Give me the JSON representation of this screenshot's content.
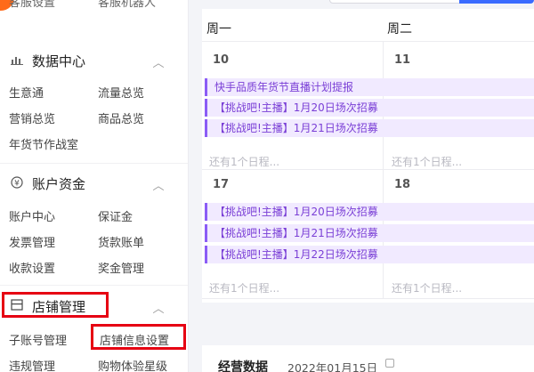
{
  "sidebar": {
    "top_partial": {
      "left": "客服设置",
      "right": "客服机器人"
    },
    "sections": [
      {
        "icon": "chart-icon",
        "title": "数据中心",
        "items": [
          [
            "生意通",
            "流量总览"
          ],
          [
            "营销总览",
            "商品总览"
          ],
          [
            "年货节作战室",
            ""
          ]
        ]
      },
      {
        "icon": "yen-icon",
        "title": "账户资金",
        "items": [
          [
            "账户中心",
            "保证金"
          ],
          [
            "发票管理",
            "货款账单"
          ],
          [
            "收款设置",
            "奖金管理"
          ]
        ]
      },
      {
        "icon": "store-icon",
        "title": "店铺管理",
        "items": [
          [
            "子账号管理",
            "店铺信息设置"
          ],
          [
            "违规管理",
            "购物体验星级"
          ]
        ]
      }
    ]
  },
  "calendar": {
    "weekdays": [
      "周一",
      "周二"
    ],
    "weeks": [
      {
        "dates": [
          "10",
          "11"
        ],
        "events": [
          "快手品质年货节直播计划提报",
          "【挑战吧!主播】1月20日场次招募",
          "【挑战吧!主播】1月21日场次招募"
        ],
        "more": [
          "还有1个日程...",
          "还有1个日程..."
        ]
      },
      {
        "dates": [
          "17",
          "18"
        ],
        "events": [
          "【挑战吧!主播】1月20日场次招募",
          "【挑战吧!主播】1月21日场次招募",
          "【挑战吧!主播】1月22日场次招募"
        ],
        "more": [
          "还有1个日程...",
          "还有1个日程..."
        ]
      }
    ]
  },
  "business": {
    "title": "经营数据",
    "date": "2022年01月15日"
  },
  "colors": {
    "accent": "#3a6bff",
    "brand": "#ff6a1a",
    "highlight": "#e60012",
    "event_bg": "#f1eaff",
    "event_text": "#7a3fd6"
  }
}
